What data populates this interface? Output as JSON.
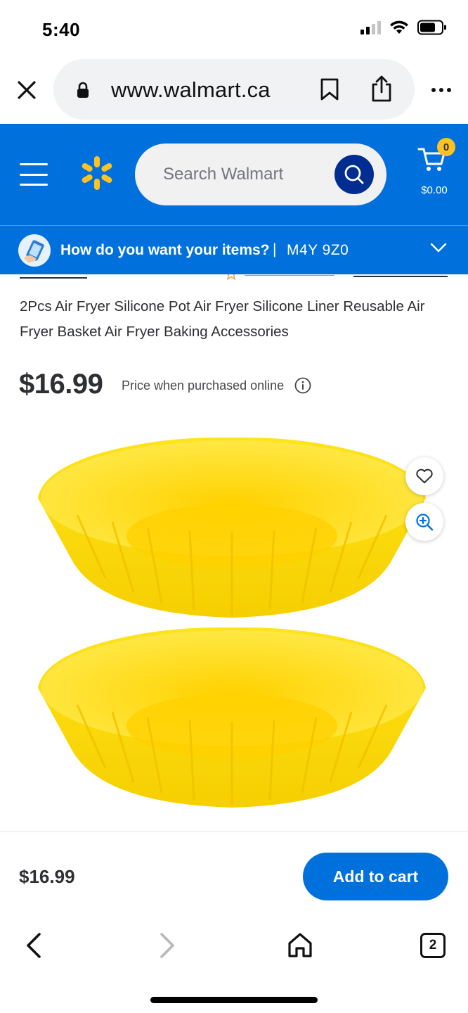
{
  "status_bar": {
    "time": "5:40"
  },
  "browser": {
    "url": "www.walmart.ca",
    "tab_count": "2"
  },
  "header": {
    "search_placeholder": "Search Walmart",
    "cart_count": "0",
    "cart_total": "$0.00",
    "brand_color": "#0071dc",
    "spark_color": "#ffc220"
  },
  "location": {
    "question": "How do you want your items?",
    "separator": "|",
    "postal_code": "M4Y 9Z0"
  },
  "product": {
    "title": "2Pcs Air Fryer Silicone Pot Air Fryer Silicone Liner Reusable Air Fryer Basket Air Fryer Baking Accessories",
    "price": "$16.99",
    "price_note": "Price when purchased online",
    "image_color": "#ffe100"
  },
  "sticky": {
    "price": "$16.99",
    "add_to_cart_label": "Add to cart"
  },
  "icons": [
    "close-icon",
    "lock-icon",
    "bookmark-icon",
    "share-icon",
    "more-icon",
    "menu-icon",
    "spark-icon",
    "search-icon",
    "cart-icon",
    "chevron-down-icon",
    "info-icon",
    "heart-icon",
    "zoom-in-icon",
    "back-icon",
    "forward-icon",
    "home-icon",
    "tabs-icon"
  ]
}
